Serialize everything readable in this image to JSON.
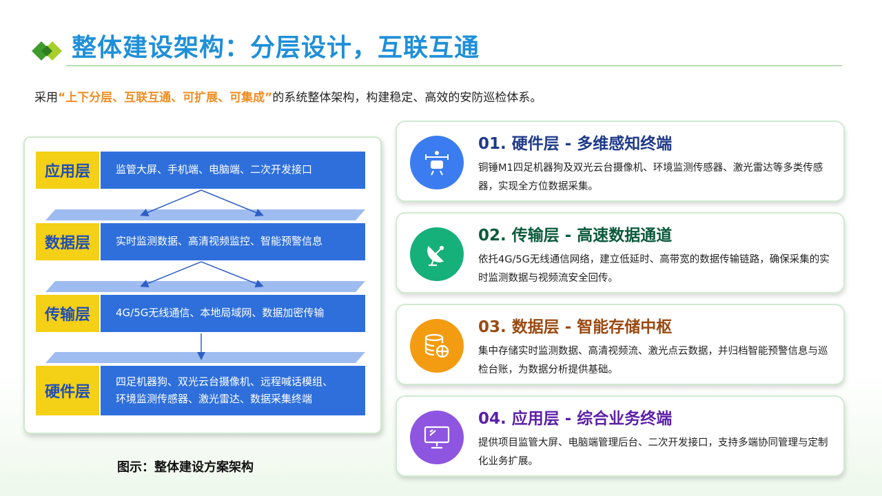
{
  "header": {
    "title": "整体建设架构：分层设计，互联互通"
  },
  "intro": {
    "prefix": "采用",
    "highlight": "“上下分层、互联互通、可扩展、可集成”",
    "suffix": "的系统整体架构，构建稳定、高效的安防巡检体系。"
  },
  "diagram": {
    "layers": [
      {
        "name": "应用层",
        "lines": [
          "监管大屏、手机端、电脑端、二次开发接口"
        ]
      },
      {
        "name": "数据层",
        "lines": [
          "实时监测数据、高清视频监控、智能预警信息"
        ]
      },
      {
        "name": "传输层",
        "lines": [
          "4G/5G无线通信、本地局域网、数据加密传输"
        ]
      },
      {
        "name": "硬件层",
        "lines": [
          "四足机器狗、双光云台摄像机、远程喊话模组、",
          "环境监测传感器、激光雷达、数据采集终端"
        ]
      }
    ],
    "caption": "图示：整体建设方案架构"
  },
  "cards": [
    {
      "title": "01. 硬件层 - 多维感知终端",
      "desc": "铜锤M1四足机器狗及双光云台摄像机、环境监测传感器、激光雷达等多类传感器，实现全方位数据采集。",
      "color": "#3b7cf0",
      "title_color": "#1f3a8a",
      "icon": "sensor-icon"
    },
    {
      "title": "02. 传输层 - 高速数据通道",
      "desc": "依托4G/5G无线通信网络，建立低延时、高带宽的数据传输链路，确保采集的实时监测数据与视频流安全回传。",
      "color": "#16b07a",
      "title_color": "#0b5a3c",
      "icon": "satellite-dish-icon"
    },
    {
      "title": "03. 数据层 - 智能存储中枢",
      "desc": "集中存储实时监测数据、高清视频流、激光点云数据，并归档智能预警信息与巡检台账，为数据分析提供基础。",
      "color": "#f39c12",
      "title_color": "#9a4a12",
      "icon": "database-icon"
    },
    {
      "title": "04. 应用层 - 综合业务终端",
      "desc": "提供项目监管大屏、电脑端管理后台、二次开发接口，支持多端协同管理与定制化业务扩展。",
      "color": "#8e55e0",
      "title_color": "#5b1fa8",
      "icon": "monitor-icon"
    }
  ]
}
